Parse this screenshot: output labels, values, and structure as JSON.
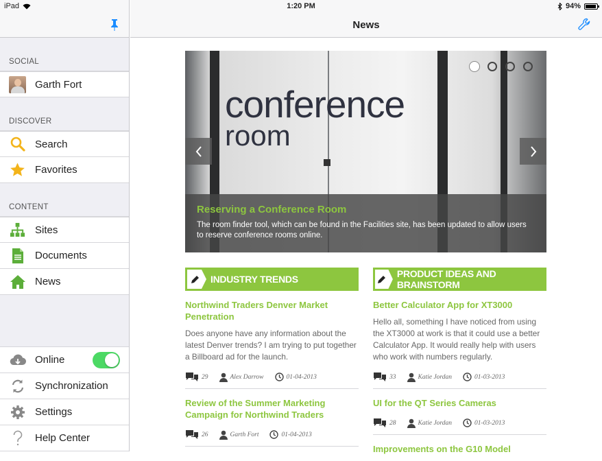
{
  "status_bar": {
    "device": "iPad",
    "time": "1:20 PM",
    "battery": "94%"
  },
  "sidebar": {
    "sections": [
      {
        "label": "SOCIAL",
        "items": [
          {
            "label": "Garth Fort",
            "icon": "avatar"
          }
        ]
      },
      {
        "label": "DISCOVER",
        "items": [
          {
            "label": "Search",
            "icon": "search-icon"
          },
          {
            "label": "Favorites",
            "icon": "star-icon"
          }
        ]
      },
      {
        "label": "CONTENT",
        "items": [
          {
            "label": "Sites",
            "icon": "sites-icon"
          },
          {
            "label": "Documents",
            "icon": "document-icon"
          },
          {
            "label": "News",
            "icon": "home-icon"
          }
        ]
      }
    ],
    "bottom": [
      {
        "label": "Online",
        "icon": "cloud-icon"
      },
      {
        "label": "Synchronization",
        "icon": "sync-icon"
      },
      {
        "label": "Settings",
        "icon": "gear-icon"
      },
      {
        "label": "Help Center",
        "icon": "question-icon"
      }
    ]
  },
  "header": {
    "title": "News"
  },
  "carousel": {
    "sign_line1": "conference",
    "sign_line2": "room",
    "title": "Reserving a Conference Room",
    "text": "The room finder tool, which can be found in the Facilities site, has been updated to allow users to reserve conference rooms online."
  },
  "columns": [
    {
      "heading": "INDUSTRY TRENDS",
      "articles": [
        {
          "title": "Northwind Traders Denver Market Penetration",
          "body": "Does anyone have any information about the latest Denver trends?  I am trying to put together a Billboard ad for the launch.",
          "comments": "29",
          "author": "Alex Darrow",
          "date": "01-04-2013"
        },
        {
          "title": "Review of the Summer Marketing Campaign for Northwind Traders",
          "body": "",
          "comments": "26",
          "author": "Garth Fort",
          "date": "01-04-2013"
        }
      ]
    },
    {
      "heading": "PRODUCT IDEAS AND BRAINSTORM",
      "articles": [
        {
          "title": "Better Calculator App for XT3000",
          "body": "Hello all, something I have noticed from using the XT3000 at work is that it could use a better Calculator App.  It would really help with users who work with numbers regularly.",
          "comments": "33",
          "author": "Katie Jordan",
          "date": "01-03-2013"
        },
        {
          "title": "UI for the QT Series Cameras",
          "body": "",
          "comments": "28",
          "author": "Katie Jordan",
          "date": "01-03-2013"
        },
        {
          "title": "Improvements on the G10 Model",
          "body": "",
          "comments": "",
          "author": "",
          "date": ""
        }
      ]
    }
  ],
  "colors": {
    "accent": "#8dc63f",
    "ios_blue": "#1a8cff",
    "toggle_on": "#4cd964"
  }
}
